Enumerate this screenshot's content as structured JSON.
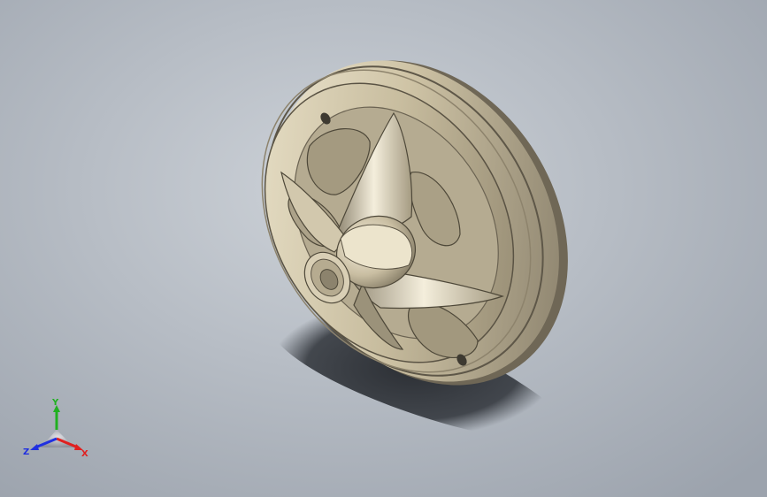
{
  "viewport": {
    "background_top": "#cdd2d8",
    "background_bottom": "#9ca3ad"
  },
  "model": {
    "name_icon": "pulley-wheel-model",
    "body_color": "#c9bfa6",
    "shadow_color": "#2a2d33"
  },
  "triad": {
    "x_label": "X",
    "y_label": "Y",
    "z_label": "Z",
    "x_color": "#e02020",
    "y_color": "#20b020",
    "z_color": "#2030e0"
  }
}
